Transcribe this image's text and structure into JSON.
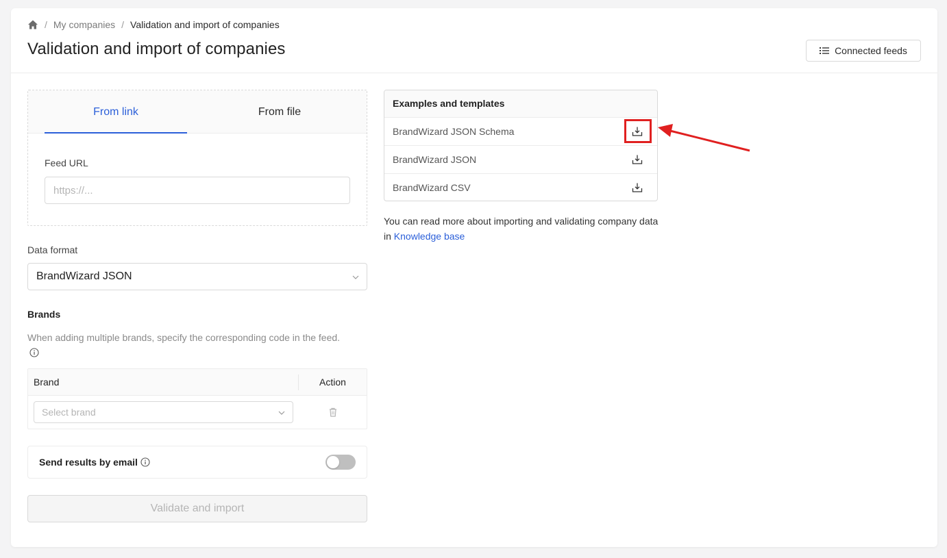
{
  "breadcrumb": {
    "home_icon": "home-icon",
    "separator": "/",
    "items": [
      "My companies",
      "Validation and import of companies"
    ]
  },
  "page": {
    "title": "Validation and import of companies",
    "connected_feeds_label": "Connected feeds",
    "connected_feeds_icon": "list-icon"
  },
  "source": {
    "tabs": [
      {
        "label": "From link",
        "active": true
      },
      {
        "label": "From file",
        "active": false
      }
    ],
    "feed_url_label": "Feed URL",
    "feed_url_placeholder": "https://...",
    "feed_url_value": ""
  },
  "data_format": {
    "label": "Data format",
    "selected": "BrandWizard JSON"
  },
  "brands": {
    "title": "Brands",
    "hint": "When adding multiple brands, specify the corresponding code in the feed.",
    "columns": [
      "Brand",
      "Action"
    ],
    "row_placeholder": "Select brand"
  },
  "email": {
    "label": "Send results by email",
    "enabled": false
  },
  "validate_button": "Validate and import",
  "examples": {
    "title": "Examples and templates",
    "items": [
      "BrandWizard JSON Schema",
      "BrandWizard JSON",
      "BrandWizard CSV"
    ]
  },
  "kb": {
    "text": "You can read more about importing and validating company data in",
    "link": "Knowledge base"
  },
  "colors": {
    "accent": "#2b5fd9",
    "annotation": "#e02020"
  }
}
